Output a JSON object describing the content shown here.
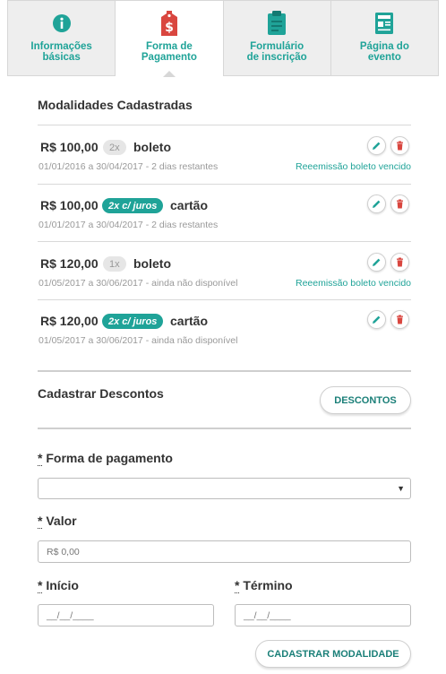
{
  "tabs": [
    {
      "label_line1": "Informações",
      "label_line2": "básicas",
      "icon": "info-icon",
      "active": false
    },
    {
      "label_line1": "Forma de",
      "label_line2": "Pagamento",
      "icon": "price-tag-icon",
      "active": true
    },
    {
      "label_line1": "Formulário",
      "label_line2": "de inscrição",
      "icon": "clipboard-icon",
      "active": false
    },
    {
      "label_line1": "Página do",
      "label_line2": "evento",
      "icon": "newspaper-icon",
      "active": false
    }
  ],
  "colors": {
    "accent": "#1fa398",
    "danger": "#d9463f",
    "tab_bg": "#eeeeee"
  },
  "modalidades": {
    "title": "Modalidades Cadastradas",
    "items": [
      {
        "price": "R$ 100,00",
        "installments": "2x",
        "installments_style": "grey",
        "method": "boleto",
        "dates": "01/01/2016 a 30/04/2017 - 2 dias restantes",
        "note": "Reeemissão boleto vencido"
      },
      {
        "price": "R$ 100,00",
        "installments": "2x c/ juros",
        "installments_style": "teal",
        "method": "cartão",
        "dates": "01/01/2017 a 30/04/2017 - 2 dias restantes",
        "note": ""
      },
      {
        "price": "R$ 120,00",
        "installments": "1x",
        "installments_style": "grey",
        "method": "boleto",
        "dates": "01/05/2017 a 30/06/2017 - ainda não disponível",
        "note": "Reeemissão boleto vencido"
      },
      {
        "price": "R$ 120,00",
        "installments": "2x c/ juros",
        "installments_style": "teal",
        "method": "cartão",
        "dates": "01/05/2017 a 30/06/2017 - ainda não disponível",
        "note": ""
      }
    ]
  },
  "descontos": {
    "title": "Cadastrar Descontos",
    "button": "DESCONTOS"
  },
  "form": {
    "payment_label_req": "*",
    "payment_label": " Forma de pagamento",
    "payment_value": "",
    "value_label_req": "*",
    "value_label": " Valor",
    "value_placeholder": "R$ 0,00",
    "start_label_req": "*",
    "start_label": " Início",
    "start_placeholder": "__/__/____",
    "end_label_req": "*",
    "end_label": " Término",
    "end_placeholder": "__/__/____",
    "submit": "CADASTRAR MODALIDADE"
  }
}
